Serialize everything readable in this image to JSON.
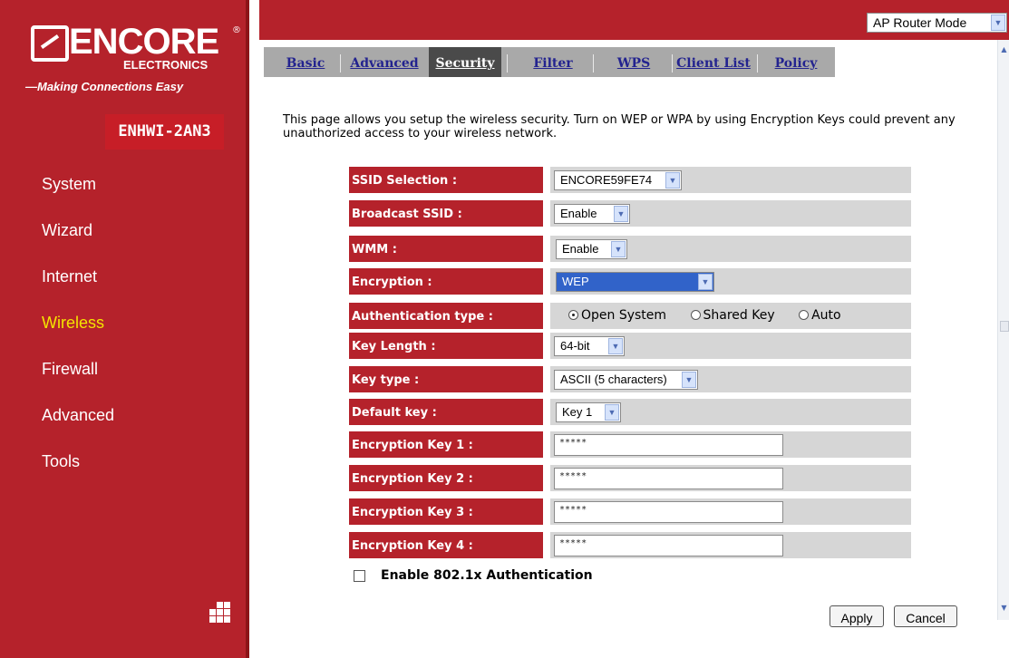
{
  "brand": {
    "logo_word": "ENCORE",
    "logo_reg": "®",
    "logo_sub": "ELECTRONICS",
    "tagline": "—Making Connections Easy",
    "model": "ENHWI-2AN3"
  },
  "sidebar": {
    "items": [
      {
        "label": "System"
      },
      {
        "label": "Wizard"
      },
      {
        "label": "Internet"
      },
      {
        "label": "Wireless"
      },
      {
        "label": "Firewall"
      },
      {
        "label": "Advanced"
      },
      {
        "label": "Tools"
      }
    ],
    "active": "Wireless"
  },
  "topbar": {
    "mode": "AP Router Mode"
  },
  "tabs": [
    {
      "label": "Basic"
    },
    {
      "label": "Advanced"
    },
    {
      "label": "Security"
    },
    {
      "label": "Filter"
    },
    {
      "label": "WPS"
    },
    {
      "label": "Client List"
    },
    {
      "label": "Policy"
    }
  ],
  "active_tab": "Security",
  "description": "This page allows you setup the wireless security. Turn on WEP or WPA by using Encryption Keys could prevent any unauthorized access to your wireless network.",
  "form": {
    "ssid_selection": {
      "label": "SSID Selection :",
      "value": "ENCORE59FE74"
    },
    "broadcast_ssid": {
      "label": "Broadcast SSID :",
      "value": "Enable"
    },
    "wmm": {
      "label": "WMM :",
      "value": "Enable"
    },
    "encryption": {
      "label": "Encryption :",
      "value": "WEP"
    },
    "authentication_type": {
      "label": "Authentication type :",
      "options": [
        "Open System",
        "Shared Key",
        "Auto"
      ],
      "selected": "Open System"
    },
    "key_length": {
      "label": "Key Length :",
      "value": "64-bit"
    },
    "key_type": {
      "label": "Key type :",
      "value": "ASCII (5 characters)"
    },
    "default_key": {
      "label": "Default key :",
      "value": "Key 1"
    },
    "encryption_key_1": {
      "label": "Encryption Key 1 :",
      "value": "*****"
    },
    "encryption_key_2": {
      "label": "Encryption Key 2 :",
      "value": "*****"
    },
    "encryption_key_3": {
      "label": "Encryption Key 3 :",
      "value": "*****"
    },
    "encryption_key_4": {
      "label": "Encryption Key 4 :",
      "value": "*****"
    },
    "enable_8021x": {
      "label": "Enable 802.1x Authentication",
      "checked": false
    }
  },
  "buttons": {
    "apply": "Apply",
    "cancel": "Cancel"
  },
  "colors": {
    "brand_red": "#b5222b",
    "nav_active": "#f4e400",
    "tab_active_bg": "#4a4a4a",
    "tab_bar_bg": "#a9a9a9",
    "field_bg": "#d6d6d6",
    "select_highlight": "#3163c9"
  },
  "icons": {
    "sidebar_bottom": "grid-icon",
    "dropdown": "chevron-down-icon"
  }
}
